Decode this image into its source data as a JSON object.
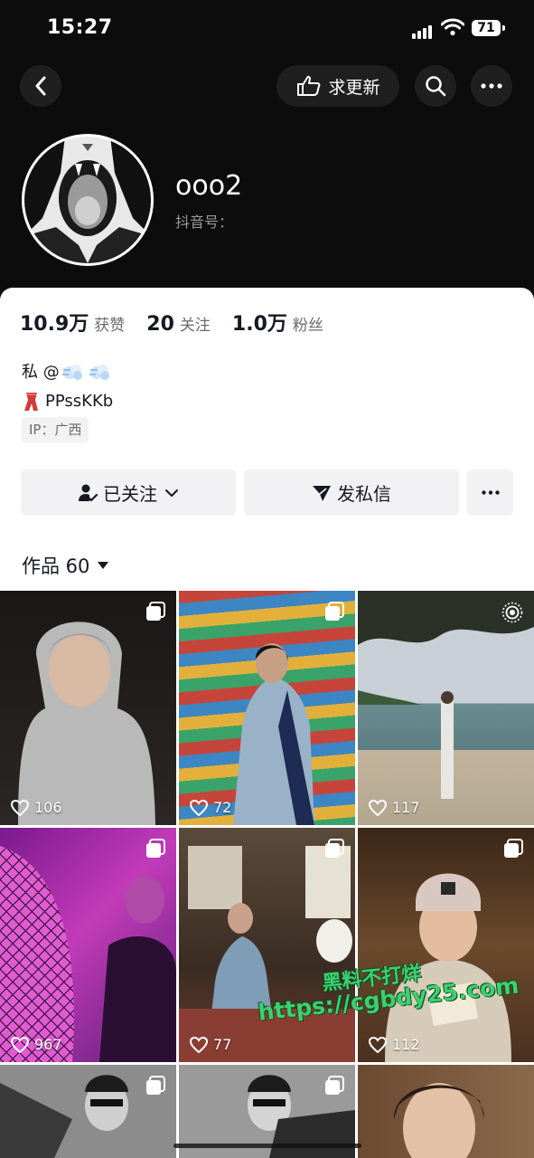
{
  "status_bar": {
    "time": "15:27",
    "battery": "71"
  },
  "nav": {
    "update_label": "求更新"
  },
  "profile": {
    "username": "ooo2",
    "douyin_id_label": "抖音号："
  },
  "stats": [
    {
      "value": "10.9万",
      "label": "获赞"
    },
    {
      "value": "20",
      "label": "关注"
    },
    {
      "value": "1.0万",
      "label": "粉丝"
    }
  ],
  "bio": {
    "line1": "私 @",
    "line2": "PPssKKb"
  },
  "ip": "IP：广西",
  "actions": {
    "follow": "已关注",
    "message": "发私信"
  },
  "works": {
    "label": "作品 60"
  },
  "videos": [
    {
      "likes": "106",
      "badge": "multi"
    },
    {
      "likes": "72",
      "badge": "multi"
    },
    {
      "likes": "117",
      "badge": "live"
    },
    {
      "likes": "967",
      "badge": "multi"
    },
    {
      "likes": "77",
      "badge": "multi"
    },
    {
      "likes": "112",
      "badge": "multi"
    },
    {
      "likes": "",
      "badge": "multi"
    },
    {
      "likes": "",
      "badge": "multi"
    },
    {
      "likes": "",
      "badge": ""
    }
  ],
  "watermark": {
    "line1": "黑料不打烊",
    "line2": "https://cgbdy25.com"
  },
  "colors": {
    "header_bg": "#0c0c0c",
    "card_bg": "#ffffff",
    "button_bg": "#f2f2f4",
    "watermark": "#3ed070"
  }
}
